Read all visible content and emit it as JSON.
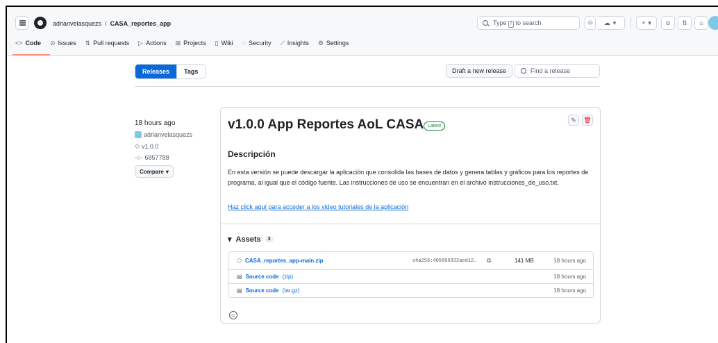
{
  "header": {
    "owner": "adrianvelasquezs",
    "separator": "/",
    "repo": "CASA_reportes_app",
    "search_prefix": "Type",
    "search_key": "/",
    "search_suffix": "to search",
    "add_label": "+",
    "caret": "▾"
  },
  "tabs": [
    {
      "label": "Code",
      "icon": "code-icon"
    },
    {
      "label": "Issues",
      "icon": "issue-icon"
    },
    {
      "label": "Pull requests",
      "icon": "pr-icon"
    },
    {
      "label": "Actions",
      "icon": "play-icon"
    },
    {
      "label": "Projects",
      "icon": "table-icon"
    },
    {
      "label": "Wiki",
      "icon": "book-icon"
    },
    {
      "label": "Security",
      "icon": "shield-icon"
    },
    {
      "label": "Insights",
      "icon": "graph-icon"
    },
    {
      "label": "Settings",
      "icon": "gear-icon"
    }
  ],
  "subnav": {
    "releases": "Releases",
    "tags": "Tags"
  },
  "actions": {
    "draft": "Draft a new release",
    "find_placeholder": "Find a release"
  },
  "release": {
    "time": "18 hours ago",
    "author": "adrianvelasquezs",
    "tag": "v1.0.0",
    "commit": "6857788",
    "compare": "Compare",
    "title": "v1.0.0 App Reportes AoL CASA",
    "badge": "Latest",
    "heading": "Descripción",
    "body": "En esta versión se puede descargar la aplicación que consolida las bases de datos y genera tablas y gráficos para los reportes de programa, al igual que el código fuente. Las instrucciones de uso se encuentran en el archivo instrucciones_de_uso.txt.",
    "link": "Haz click aquí para acceder a los video tutoriales de la aplicación"
  },
  "assets": {
    "title": "Assets",
    "count": "3",
    "items": [
      {
        "name": "CASA_reportes_app-main.zip",
        "suffix": "",
        "sha": "sha256:405895832aed12…",
        "size": "141 MB",
        "date": "18 hours ago"
      },
      {
        "name": "Source code",
        "suffix": "(zip)",
        "sha": "",
        "size": "",
        "date": "18 hours ago"
      },
      {
        "name": "Source code",
        "suffix": "(tar.gz)",
        "sha": "",
        "size": "",
        "date": "18 hours ago"
      }
    ]
  },
  "colors": {
    "accent": "#0969da",
    "latest": "#1a7f37",
    "danger": "#cf222e",
    "tab_underline": "#fd8c73"
  }
}
